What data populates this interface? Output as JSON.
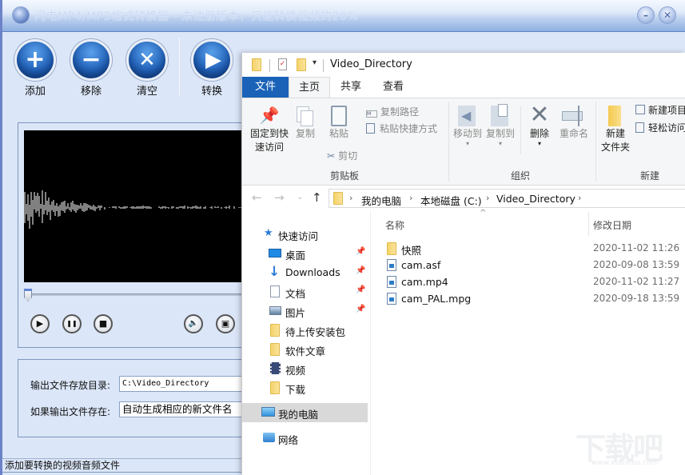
{
  "converter": {
    "title": "闪电MP4/MP3格式转换器 - 未注册版本，只能转换视频的20%",
    "window_controls": {
      "minimize": "–",
      "close": "✕"
    },
    "toolbar": [
      {
        "label": "添加",
        "icon": "plus-icon",
        "glyph": "+"
      },
      {
        "label": "移除",
        "icon": "minus-icon",
        "glyph": "−"
      },
      {
        "label": "清空",
        "icon": "clear-x-icon",
        "glyph": "✕"
      },
      {
        "label": "转换",
        "icon": "convert-play-icon",
        "glyph": "▶"
      }
    ],
    "hidden_toolbar_icons": [
      "gray-circle-icon",
      "gray-circle-icon",
      "blue-circle-icon",
      "blue-up-icon",
      "blue-help-icon"
    ],
    "player": {
      "seek_progress": 0,
      "controls": [
        {
          "name": "play",
          "icon": "play-icon",
          "glyph": "▶"
        },
        {
          "name": "pause",
          "icon": "pause-icon",
          "glyph": "❚❚"
        },
        {
          "name": "stop",
          "icon": "stop-icon",
          "glyph": "■"
        },
        {
          "name": "volume",
          "icon": "speaker-icon",
          "glyph": "🔈"
        },
        {
          "name": "snapshot",
          "icon": "camera-icon",
          "glyph": "▣"
        }
      ]
    },
    "output": {
      "dir_label": "输出文件存放目录:",
      "dir_value": "C:\\Video_Directory",
      "exists_label": "如果输出文件存在:",
      "exists_value": "自动生成相应的新文件名"
    },
    "status": "添加要转换的视频音频文件"
  },
  "explorer": {
    "title": "Video_Directory",
    "tabs": {
      "file": "文件",
      "home": "主页",
      "share": "共享",
      "view": "查看"
    },
    "ribbon": {
      "pin_quick_access": "固定到快速访问",
      "pin_l1": "固定到快",
      "pin_l2": "速访问",
      "copy": "复制",
      "paste": "粘贴",
      "copy_path": "复制路径",
      "paste_shortcut": "粘贴快捷方式",
      "cut": "剪切",
      "clipboard_group": "剪贴板",
      "move_to": "移动到",
      "copy_to": "复制到",
      "delete": "删除",
      "rename": "重命名",
      "organize_group": "组织",
      "new_folder_l1": "新建",
      "new_folder_l2": "文件夹",
      "new_item": "新建项目",
      "easy_access": "轻松访问",
      "new_group": "新建"
    },
    "breadcrumb": [
      "我的电脑",
      "本地磁盘 (C:)",
      "Video_Directory"
    ],
    "nav": {
      "quick_access": "快速访问",
      "items": [
        {
          "label": "桌面",
          "icon": "desktop-icon",
          "pinned": true
        },
        {
          "label": "Downloads",
          "icon": "download-arrow-icon",
          "pinned": true
        },
        {
          "label": "文档",
          "icon": "document-icon",
          "pinned": true
        },
        {
          "label": "图片",
          "icon": "pictures-icon",
          "pinned": true
        },
        {
          "label": "待上传安装包",
          "icon": "folder-icon",
          "pinned": false
        },
        {
          "label": "软件文章",
          "icon": "folder-icon",
          "pinned": false
        },
        {
          "label": "视频",
          "icon": "video-film-icon",
          "pinned": false
        },
        {
          "label": "下载",
          "icon": "folder-icon",
          "pinned": false
        }
      ],
      "this_pc": "我的电脑",
      "network": "网络"
    },
    "columns": {
      "name": "名称",
      "modified": "修改日期"
    },
    "files": [
      {
        "name": "快照",
        "type": "folder",
        "modified": "2020-11-02 11:26"
      },
      {
        "name": "cam.asf",
        "type": "video",
        "modified": "2020-09-08 13:59"
      },
      {
        "name": "cam.mp4",
        "type": "video",
        "modified": "2020-11-02 11:27"
      },
      {
        "name": "cam_PAL.mpg",
        "type": "video",
        "modified": "2020-09-18 13:59"
      }
    ]
  },
  "watermark": {
    "text": "下载吧",
    "url": "www.xiazaiba.com"
  },
  "colors": {
    "explorer_accent": "#1a62b8",
    "app_bg": "#dbe6f8",
    "toolbar_blue": "#1f5fb8"
  }
}
